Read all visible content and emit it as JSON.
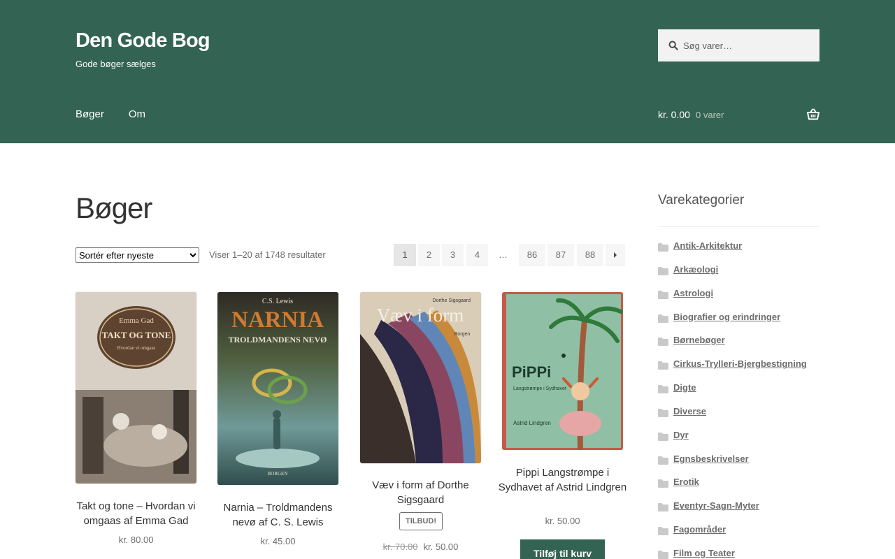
{
  "header": {
    "site_title": "Den Gode Bog",
    "tagline": "Gode bøger sælges",
    "search_placeholder": "Søg varer…",
    "nav": [
      "Bøger",
      "Om"
    ],
    "cart": {
      "amount": "kr. 0.00",
      "count": "0 varer"
    },
    "colors": {
      "header_bg": "#336352"
    }
  },
  "main": {
    "page_title": "Bøger",
    "orderby_selected": "Sortér efter nyeste",
    "result_count": "Viser 1–20 af 1748 resultater",
    "pagination": {
      "pages": [
        "1",
        "2",
        "3",
        "4",
        "…",
        "86",
        "87",
        "88"
      ],
      "current": "1",
      "next_icon": "next-arrow-icon"
    },
    "products": [
      {
        "title": "Takt og tone – Hvordan vi omgaas af Emma Gad",
        "price": "kr. 80.00",
        "cover_text": [
          "Emma Gad",
          "TAKT OG TONE",
          "Hvordan vi omgaas"
        ]
      },
      {
        "title": "Narnia – Troldmandens nevø af C. S. Lewis",
        "price": "kr. 45.00",
        "cover_text": [
          "C.S. Lewis",
          "NARNIA",
          "TROLDMANDENS NEVØ",
          "BORGEN"
        ]
      },
      {
        "title": "Væv i form af Dorthe Sigsgaard",
        "badge": "TILBUD!",
        "old_price": "kr. 70.00",
        "price": "kr. 50.00",
        "cover_text": [
          "Dorthe Sigsgaard",
          "Væv i form",
          "Borgen"
        ]
      },
      {
        "title": "Pippi Langstrømpe i Sydhavet af Astrid Lindgren",
        "price": "kr. 50.00",
        "button": "Tilføj til kurv",
        "cover_text": [
          "PiPPi",
          "Langstrømpe i Sydhavet",
          "Astrid Lindgren"
        ]
      }
    ]
  },
  "sidebar": {
    "title": "Varekategorier",
    "categories": [
      "Antik-Arkitektur",
      "Arkæologi",
      "Astrologi",
      "Biografier og erindringer",
      "Børnebøger",
      "Cirkus-Trylleri-Bjergbestigning",
      "Digte",
      "Diverse",
      "Dyr",
      "Egnsbeskrivelser",
      "Erotik",
      "Eventyr-Sagn-Myter",
      "Fagområder",
      "Film og Teater"
    ]
  }
}
